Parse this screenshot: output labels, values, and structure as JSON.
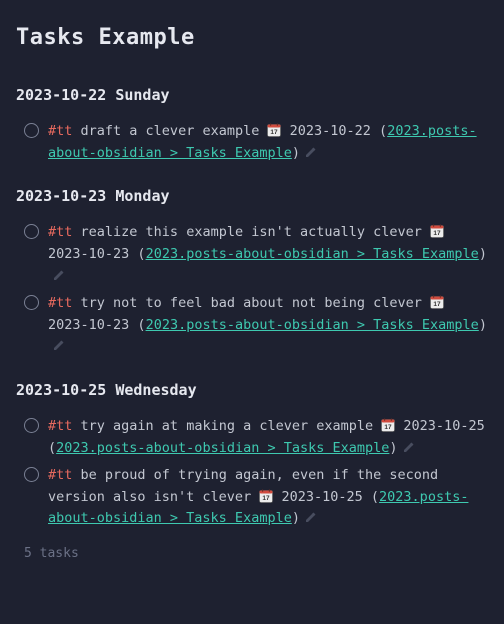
{
  "title": "Tasks Example",
  "tag": "#tt",
  "source_link": "2023.posts-about-obsidian > Tasks Example",
  "groups": [
    {
      "heading": "2023-10-22 Sunday",
      "tasks": [
        {
          "text": "draft a clever example",
          "date": "2023-10-22"
        }
      ]
    },
    {
      "heading": "2023-10-23 Monday",
      "tasks": [
        {
          "text": "realize this example isn't actually clever",
          "date": "2023-10-23"
        },
        {
          "text": "try not to feel bad about not being clever",
          "date": "2023-10-23"
        }
      ]
    },
    {
      "heading": "2023-10-25 Wednesday",
      "tasks": [
        {
          "text": "try again at making a clever example",
          "date": "2023-10-25"
        },
        {
          "text": "be proud of trying again, even if the second version also isn't clever",
          "date": "2023-10-25"
        }
      ]
    }
  ],
  "footer": "5 tasks"
}
